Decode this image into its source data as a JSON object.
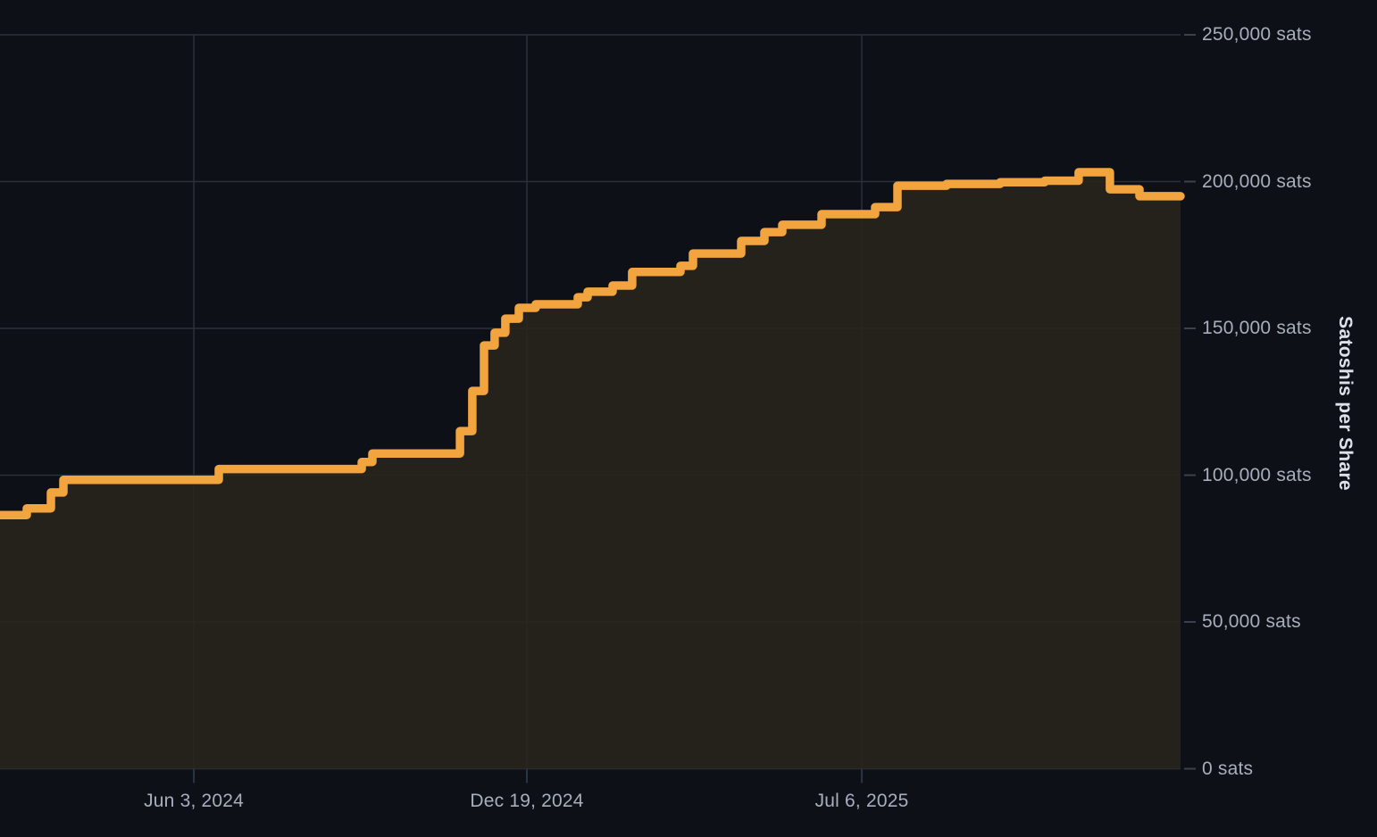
{
  "colors": {
    "background": "#0d1017",
    "line": "#f2a43e",
    "area_fill": "rgba(41,36,29,0.88)",
    "gridline": "#2b303a",
    "axis_tick": "#3c414d",
    "date_tick": "#2b3444",
    "label": "#a8aebc",
    "title": "#dde1e9"
  },
  "chart_data": {
    "type": "area",
    "variant": "step-after",
    "title": "",
    "xlabel": "",
    "ylabel": "Satoshis per Share",
    "grid": true,
    "legend": false,
    "y_axis": {
      "side": "right",
      "range": [
        0,
        250000
      ],
      "tick_values": [
        0,
        50000,
        100000,
        150000,
        200000,
        250000
      ],
      "tick_labels": [
        "0 sats",
        "50,000 sats",
        "100,000 sats",
        "150,000 sats",
        "200,000 sats",
        "250,000 sats"
      ]
    },
    "x_axis": {
      "tick_labels": [
        "Jun 3, 2024",
        "Dec 19, 2024",
        "Jul 6, 2025"
      ],
      "tick_positions_frac": [
        0.1642,
        0.4463,
        0.73
      ]
    },
    "series": [
      {
        "name": "Satoshis per Share",
        "end_x_frac": 1.0,
        "points": [
          {
            "x_frac": 0.0,
            "sats": 86400
          },
          {
            "x_frac": 0.0227,
            "sats": 88700
          },
          {
            "x_frac": 0.0431,
            "sats": 94100
          },
          {
            "x_frac": 0.0537,
            "sats": 98400
          },
          {
            "x_frac": 0.1853,
            "sats": 102100
          },
          {
            "x_frac": 0.3064,
            "sats": 104500
          },
          {
            "x_frac": 0.3154,
            "sats": 107400
          },
          {
            "x_frac": 0.3896,
            "sats": 115000
          },
          {
            "x_frac": 0.4001,
            "sats": 128700
          },
          {
            "x_frac": 0.41,
            "sats": 144200
          },
          {
            "x_frac": 0.419,
            "sats": 148500
          },
          {
            "x_frac": 0.4281,
            "sats": 153300
          },
          {
            "x_frac": 0.4395,
            "sats": 157000
          },
          {
            "x_frac": 0.4538,
            "sats": 158200
          },
          {
            "x_frac": 0.4894,
            "sats": 160600
          },
          {
            "x_frac": 0.4977,
            "sats": 162500
          },
          {
            "x_frac": 0.5189,
            "sats": 164600
          },
          {
            "x_frac": 0.5355,
            "sats": 169200
          },
          {
            "x_frac": 0.5764,
            "sats": 171300
          },
          {
            "x_frac": 0.587,
            "sats": 175500
          },
          {
            "x_frac": 0.6278,
            "sats": 179800
          },
          {
            "x_frac": 0.6475,
            "sats": 182800
          },
          {
            "x_frac": 0.6626,
            "sats": 185300
          },
          {
            "x_frac": 0.6959,
            "sats": 188900
          },
          {
            "x_frac": 0.7413,
            "sats": 191300
          },
          {
            "x_frac": 0.7602,
            "sats": 198600
          },
          {
            "x_frac": 0.8018,
            "sats": 199200
          },
          {
            "x_frac": 0.8472,
            "sats": 199800
          },
          {
            "x_frac": 0.885,
            "sats": 200300
          },
          {
            "x_frac": 0.9137,
            "sats": 203200
          },
          {
            "x_frac": 0.9402,
            "sats": 197400
          },
          {
            "x_frac": 0.9652,
            "sats": 195000
          }
        ]
      }
    ]
  }
}
